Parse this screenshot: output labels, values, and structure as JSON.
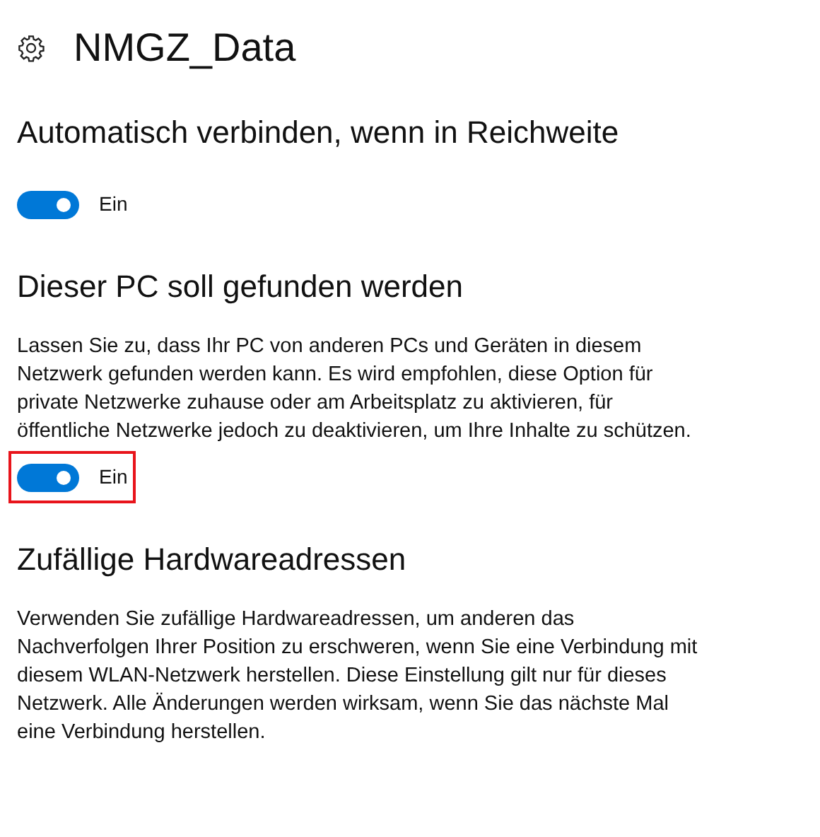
{
  "page": {
    "title": "NMGZ_Data"
  },
  "sections": [
    {
      "heading": "Automatisch verbinden, wenn in Reichweite",
      "toggle": {
        "on": true,
        "label": "Ein",
        "highlighted": false
      }
    },
    {
      "heading": "Dieser PC soll gefunden werden",
      "description": "Lassen Sie zu, dass Ihr PC von anderen PCs und Geräten in diesem Netzwerk gefunden werden kann. Es wird empfohlen, diese Option für private Netzwerke zuhause oder am Arbeitsplatz zu aktivieren, für öffentliche Netzwerke jedoch zu deaktivieren, um Ihre Inhalte zu schützen.",
      "toggle": {
        "on": true,
        "label": "Ein",
        "highlighted": true
      }
    },
    {
      "heading": "Zufällige Hardwareadressen",
      "description": "Verwenden Sie zufällige Hardwareadressen, um anderen das Nachverfolgen Ihrer Position zu erschweren, wenn Sie eine Verbindung mit diesem WLAN-Netzwerk herstellen. Diese Einstellung gilt nur für dieses Netzwerk. Alle Änderungen werden wirksam, wenn Sie das nächste Mal eine Verbindung herstellen."
    }
  ]
}
